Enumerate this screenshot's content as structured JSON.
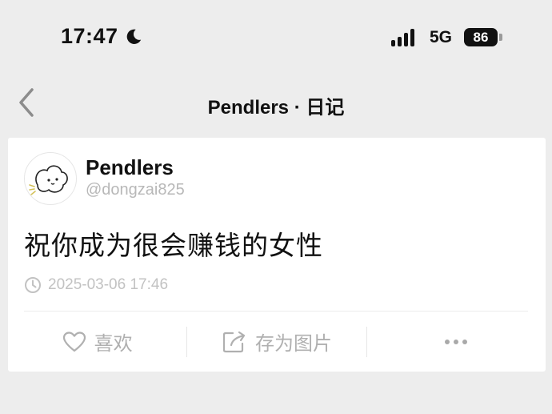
{
  "status_bar": {
    "time": "17:47",
    "network": "5G",
    "battery": "86",
    "icons": [
      "moon-icon",
      "signal-icon",
      "battery-icon"
    ]
  },
  "nav": {
    "title": "Pendlers · 日记",
    "back_icon": "chevron-left-icon"
  },
  "post": {
    "author_name": "Pendlers",
    "author_handle": "@dongzai825",
    "text": "祝你成为很会赚钱的女性",
    "timestamp": "2025-03-06 17:46",
    "timestamp_icon": "clock-icon"
  },
  "actions": {
    "like_label": "喜欢",
    "save_image_label": "存为图片",
    "like_icon": "heart-icon",
    "save_icon": "share-export-icon",
    "more_icon": "more-icon"
  },
  "colors": {
    "background": "#ededed",
    "card": "#ffffff",
    "muted_text": "#b0b0b0"
  }
}
